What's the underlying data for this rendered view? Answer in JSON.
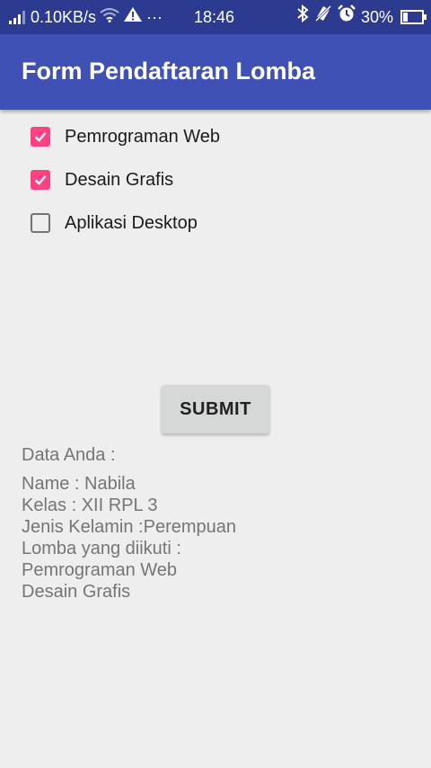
{
  "status_bar": {
    "network_speed": "0.10KB/s",
    "more": "···",
    "time": "18:46",
    "battery": "30%",
    "battery_level": 0.3
  },
  "app_bar": {
    "title": "Form Pendaftaran Lomba"
  },
  "checkboxes": [
    {
      "label": "Pemrograman Web",
      "checked": true
    },
    {
      "label": "Desain Grafis",
      "checked": true
    },
    {
      "label": "Aplikasi Desktop",
      "checked": false
    }
  ],
  "submit_label": "SUBMIT",
  "result": {
    "heading": "Data Anda :",
    "lines": [
      "Name : Nabila",
      "Kelas : XII RPL 3",
      "Jenis Kelamin :Perempuan",
      "Lomba yang diikuti :",
      "Pemrograman Web",
      "Desain Grafis"
    ]
  },
  "colors": {
    "primary": "#3f51b5",
    "primary_dark": "#2c3b90",
    "accent": "#ff4081",
    "background": "#eeeeee"
  }
}
